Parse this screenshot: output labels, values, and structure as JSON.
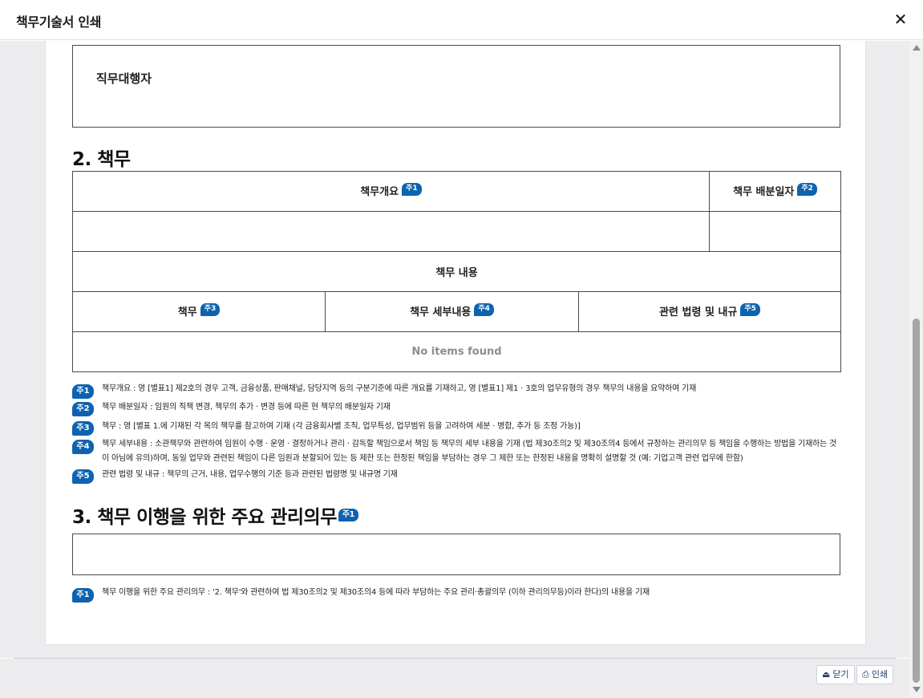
{
  "dialog": {
    "title": "책무기술서 인쇄",
    "close_icon": "✕"
  },
  "agent": {
    "label": "직무대행자"
  },
  "section2": {
    "title": "2. 책무",
    "summary_header": "책무개요",
    "summary_badge": "주1",
    "date_header": "책무 배분일자",
    "date_badge": "주2",
    "content_header": "책무 내용",
    "col_duty": "책무",
    "col_duty_badge": "주3",
    "col_detail": "책무 세부내용",
    "col_detail_badge": "주4",
    "col_law": "관련 법령 및 내규",
    "col_law_badge": "주5",
    "empty_text": "No items found",
    "notes": [
      {
        "badge": "주1",
        "text": "책무개요 : 영 [별표1] 제2호의 경우 고객, 금융상품, 판매채널, 담당지역 등의 구분기준에 따른 개요를 기재하고, 영 [별표1] 제1 · 3호의 업무유형의 경우 책무의 내용을 요약하여 기재"
      },
      {
        "badge": "주2",
        "text": "책무 배분일자 : 임원의 직책 변경, 책무의 추가 · 변경 등에 따른 현 책무의 배분일자 기재"
      },
      {
        "badge": "주3",
        "text": "책무 : 영 [별표 1.에 기재된 각 목의 책무를 참고하여 기재 (각 금융회사별 조직, 업무특성, 업무범위 등을 고려하여 세분 · 병합, 추가 등 조정 가능)]"
      },
      {
        "badge": "주4",
        "text": "책무 세부내용 : 소관책무와 관련하여 임원이 수행 · 운영 · 결정하거나 관리 · 감독할 책임으로서 책임 등 책무의 세부 내용을 기재 (법 제30조의2 및 제30조의4 등에서 규정하는 관리의무 등 책임을 수행하는 방법을 기재하는 것이 아님에 유의)하며, 동일 업무와 관련된 책임이 다른 임원과 분할되어 있는 등 제한 또는 한정된 책임을 부담하는 경우 그 제한 또는 한정된 내용을 명확히 설명할 것 (예: 기업고객 관련 업무에 한함)"
      },
      {
        "badge": "주5",
        "text": "관련 법령 및 내규 : 책무의 근거, 내용, 업무수행의 기준 등과 관련된 법령명 및 내규명 기재"
      }
    ]
  },
  "section3": {
    "title": "3. 책무 이행을 위한 주요 관리의무",
    "badge": "주1",
    "note_badge": "주1",
    "note_text": "책무 이행을 위한 주요 관리의무 : '2. 책무'와 관련하여 법 제30조의2 및 제30조의4 등에 따라 부담하는 주요 관리·총괄의무 (이하 관리의무등)이라 한다)의 내용을 기재"
  },
  "footer": {
    "close_label": "닫기",
    "close_icon": "⏏",
    "print_label": "인쇄",
    "print_icon": "⎙"
  }
}
